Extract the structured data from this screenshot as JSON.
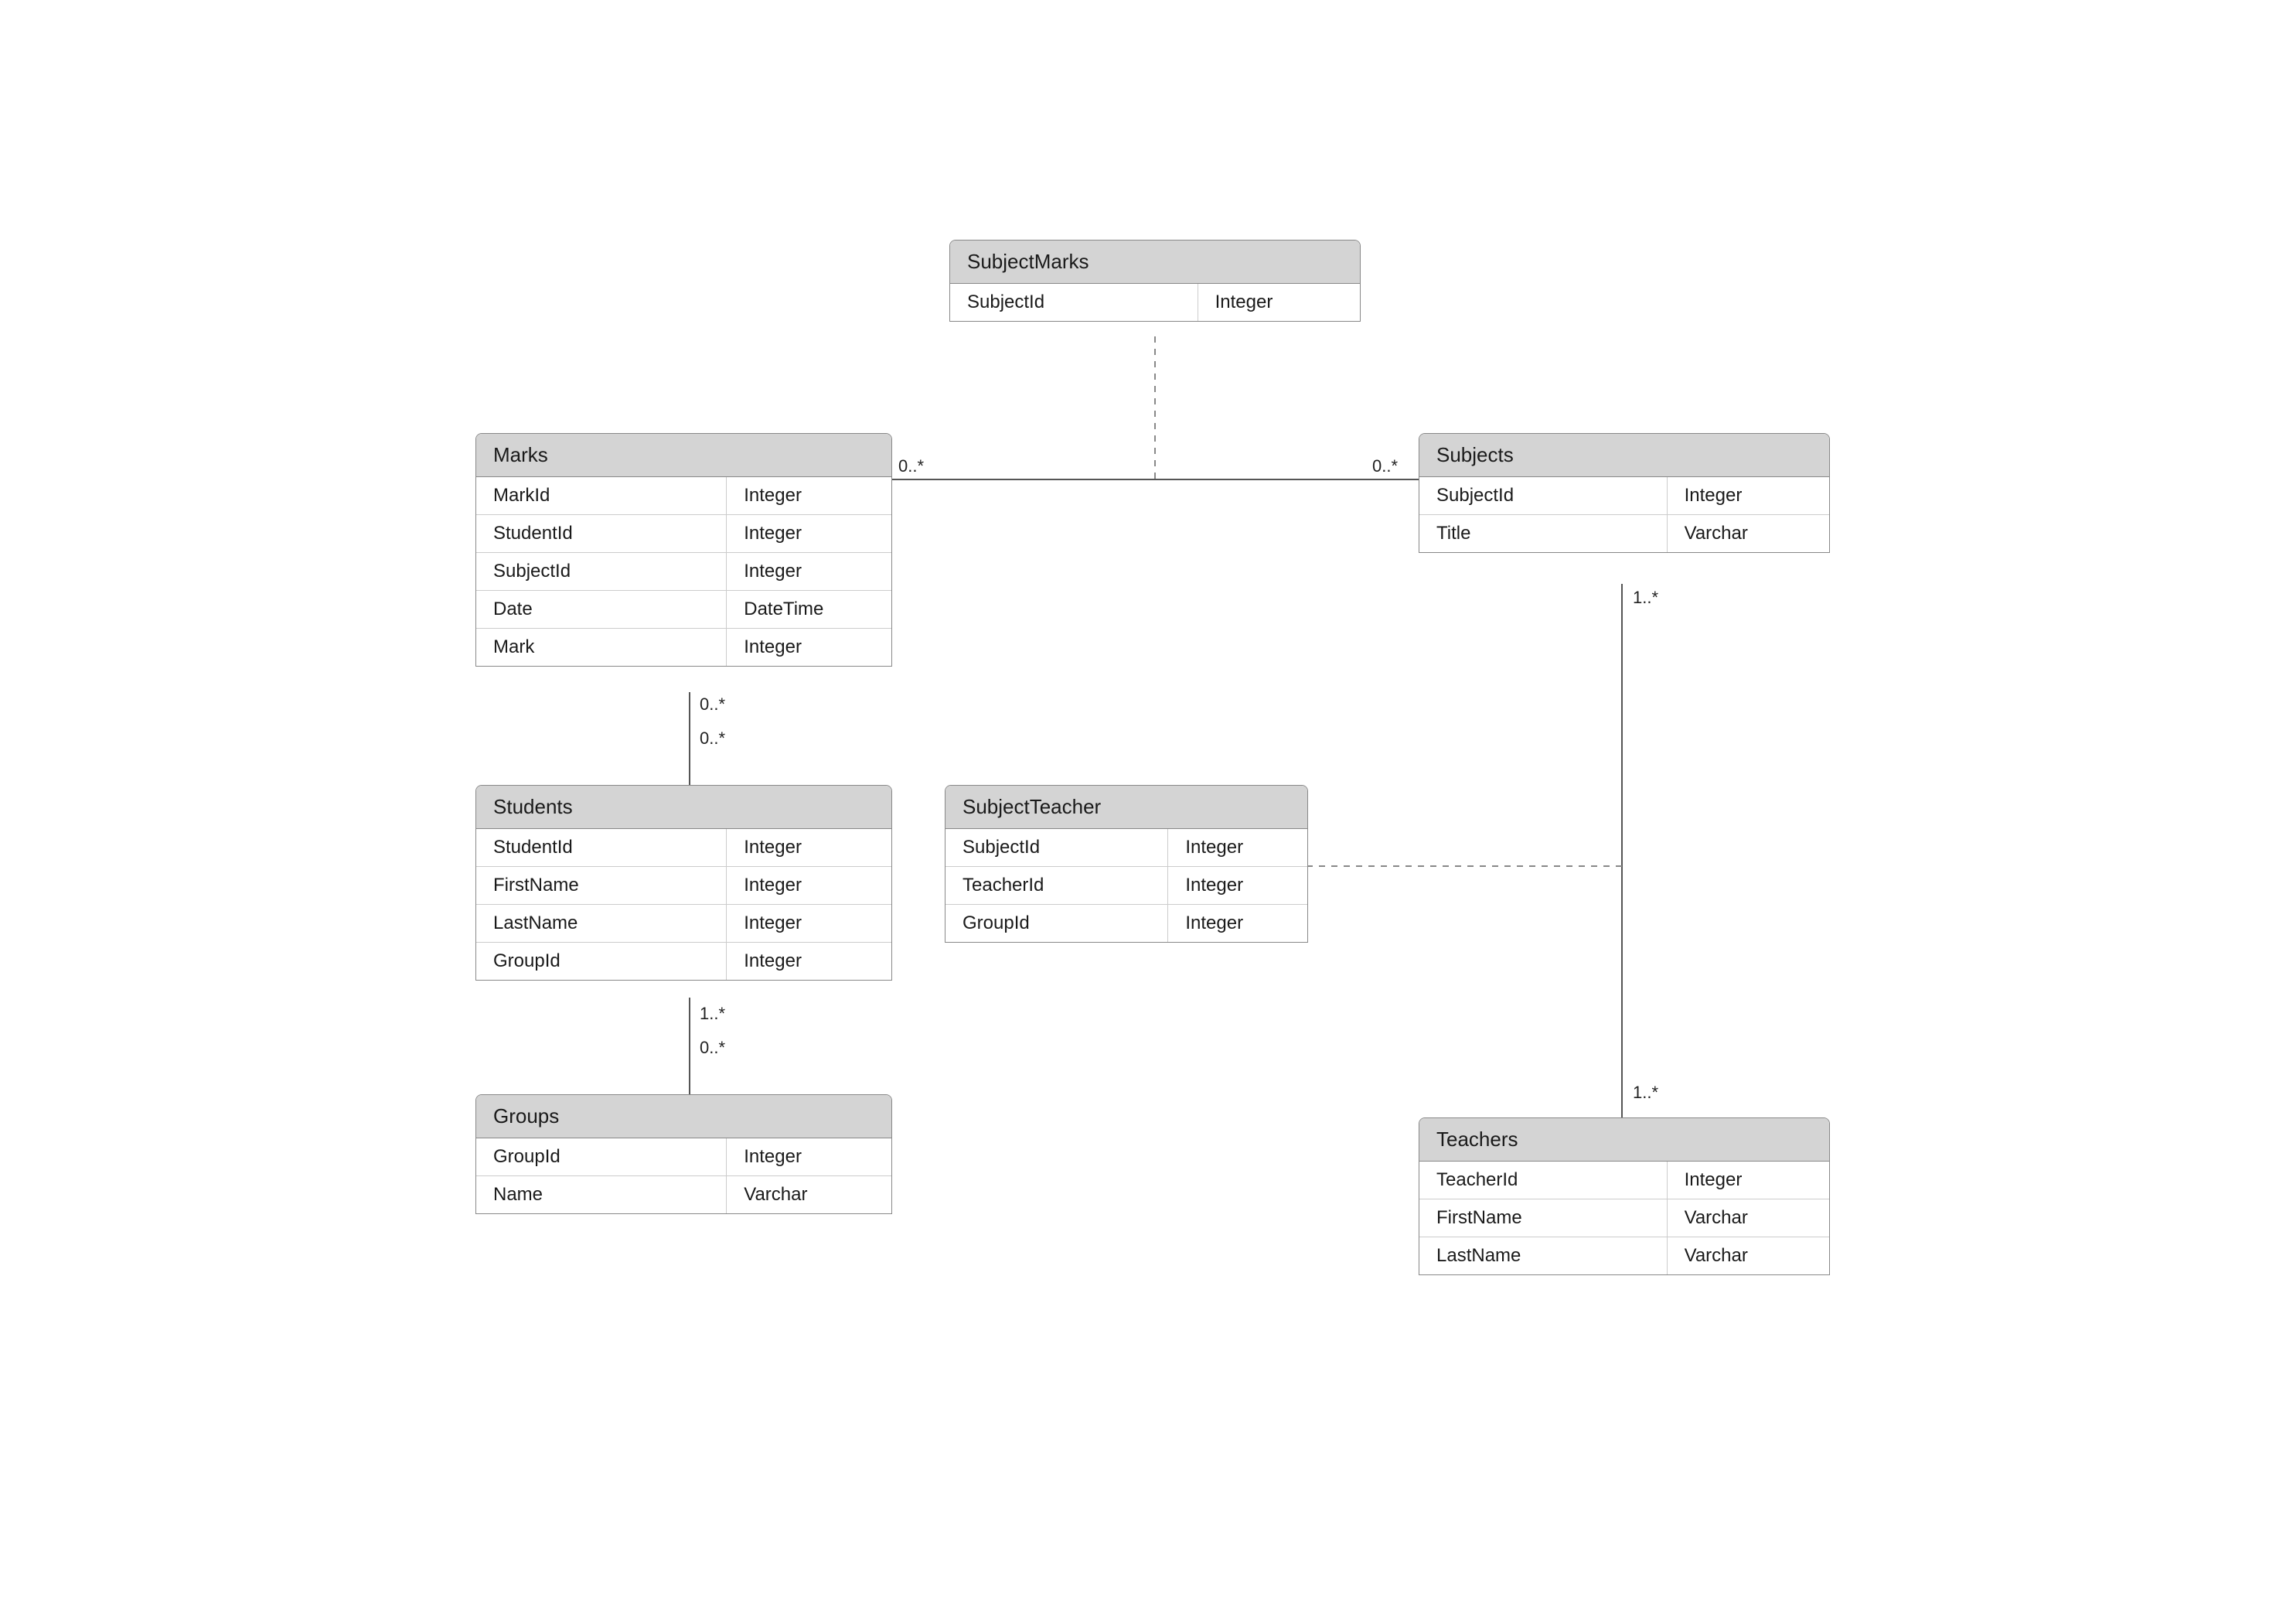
{
  "entities": {
    "subjectMarks": {
      "title": "SubjectMarks",
      "rows": [
        {
          "name": "SubjectId",
          "type": "Integer"
        }
      ]
    },
    "marks": {
      "title": "Marks",
      "rows": [
        {
          "name": "MarkId",
          "type": "Integer"
        },
        {
          "name": "StudentId",
          "type": "Integer"
        },
        {
          "name": "SubjectId",
          "type": "Integer"
        },
        {
          "name": "Date",
          "type": "DateTime"
        },
        {
          "name": "Mark",
          "type": "Integer"
        }
      ]
    },
    "subjects": {
      "title": "Subjects",
      "rows": [
        {
          "name": "SubjectId",
          "type": "Integer"
        },
        {
          "name": "Title",
          "type": "Varchar"
        }
      ]
    },
    "students": {
      "title": "Students",
      "rows": [
        {
          "name": "StudentId",
          "type": "Integer"
        },
        {
          "name": "FirstName",
          "type": "Integer"
        },
        {
          "name": "LastName",
          "type": "Integer"
        },
        {
          "name": "GroupId",
          "type": "Integer"
        }
      ]
    },
    "subjectTeacher": {
      "title": "SubjectTeacher",
      "rows": [
        {
          "name": "SubjectId",
          "type": "Integer"
        },
        {
          "name": "TeacherId",
          "type": "Integer"
        },
        {
          "name": "GroupId",
          "type": "Integer"
        }
      ]
    },
    "groups": {
      "title": "Groups",
      "rows": [
        {
          "name": "GroupId",
          "type": "Integer"
        },
        {
          "name": "Name",
          "type": "Varchar"
        }
      ]
    },
    "teachers": {
      "title": "Teachers",
      "rows": [
        {
          "name": "TeacherId",
          "type": "Integer"
        },
        {
          "name": "FirstName",
          "type": "Varchar"
        },
        {
          "name": "LastName",
          "type": "Varchar"
        }
      ]
    }
  },
  "multiplicities": {
    "marksSubjectsLeft": "0..*",
    "marksSubjectsRight": "0..*",
    "marksStudentsTop": "0..*",
    "marksStudentsBottom": "0..*",
    "subjectsTeachersTop": "1..*",
    "subjectsTeachersBottom": "1..*",
    "studentsGroupsTop": "1..*",
    "studentsGroupsBottom": "0..*"
  }
}
